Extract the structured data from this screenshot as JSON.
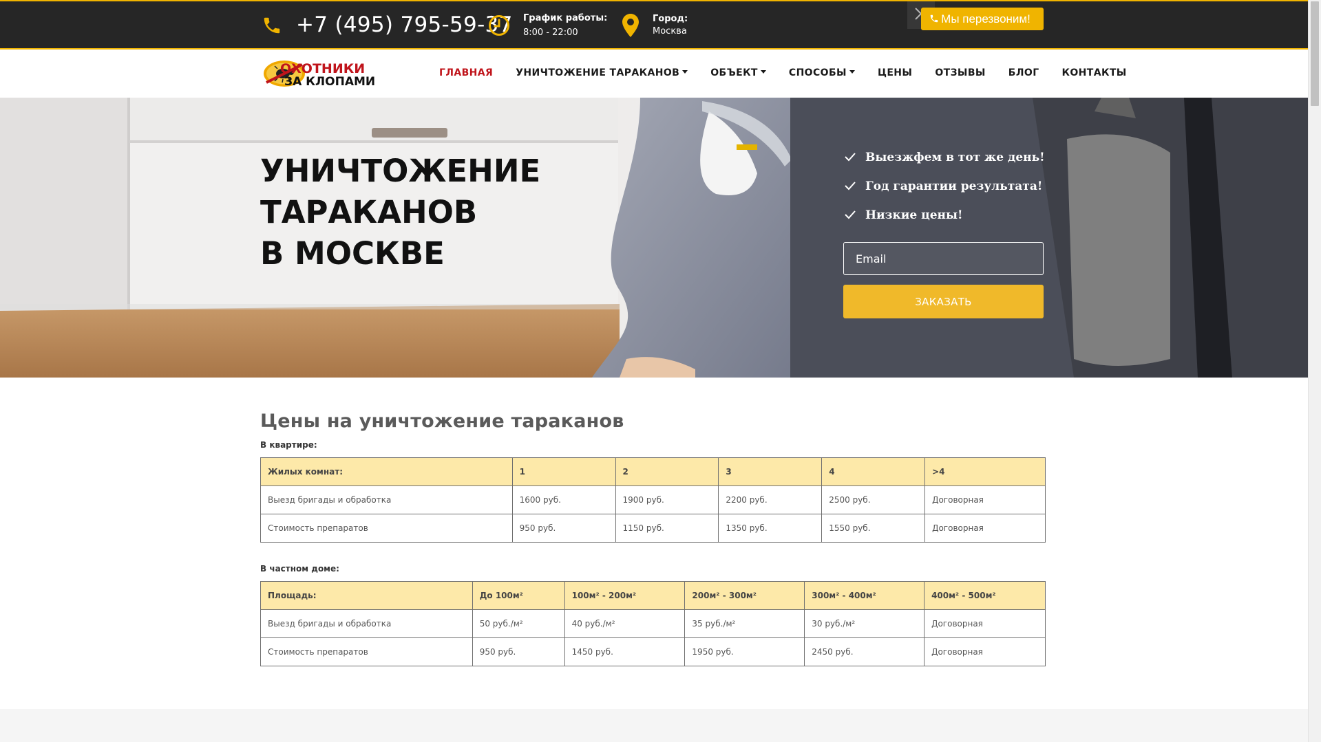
{
  "topbar": {
    "phone": "+7 (495) 795-59-37",
    "hours_label": "График работы:",
    "hours_value": "8:00 - 22:00",
    "city_label": "Город:",
    "city_value": "Москва",
    "callback_label": "Мы перезвоним!",
    "icons": [
      "phone-icon",
      "clock-icon",
      "map-pin-icon",
      "close-icon"
    ],
    "accent_color": "#f0b400",
    "background_color": "#262626"
  },
  "logo": {
    "line1": "ОХОТНИКИ",
    "line2": "ЗА КЛОПАМИ"
  },
  "nav": {
    "items": [
      {
        "label": "ГЛАВНАЯ",
        "active": true,
        "dropdown": false
      },
      {
        "label": "УНИЧТОЖЕНИЕ ТАРАКАНОВ",
        "active": false,
        "dropdown": true
      },
      {
        "label": "ОБЪЕКТ",
        "active": false,
        "dropdown": true
      },
      {
        "label": "СПОСОБЫ",
        "active": false,
        "dropdown": true
      },
      {
        "label": "ЦЕНЫ",
        "active": false,
        "dropdown": false
      },
      {
        "label": "ОТЗЫВЫ",
        "active": false,
        "dropdown": false
      },
      {
        "label": "БЛОГ",
        "active": false,
        "dropdown": false
      },
      {
        "label": "КОНТАКТЫ",
        "active": false,
        "dropdown": false
      }
    ],
    "active_color": "#c0141b"
  },
  "hero": {
    "title_line1": "УНИЧТОЖЕНИЕ ТАРАКАНОВ",
    "title_line2": "В МОСКВЕ",
    "benefits": [
      "Выезжфем в тот же день!",
      "Год гарантии результата!",
      "Низкие цены!"
    ],
    "email_placeholder": "Email",
    "order_button": "ЗАКАЗАТЬ",
    "button_color": "#f0b92a"
  },
  "prices": {
    "title": "Цены на уничтожение тараканов",
    "apartment": {
      "caption": "В квартире:",
      "header": [
        "Жилых комнат:",
        "1",
        "2",
        "3",
        "4",
        ">4"
      ],
      "rows": [
        [
          "Выезд бригады и обработка",
          "1600 руб.",
          "1900 руб.",
          "2200 руб.",
          "2500 руб.",
          "Договорная"
        ],
        [
          "Стоимость препаратов",
          "950 руб.",
          "1150 руб.",
          "1350 руб.",
          "1550 руб.",
          "Договорная"
        ]
      ]
    },
    "house": {
      "caption": "В частном доме:",
      "header": [
        "Площадь:",
        "До 100м²",
        "100м² - 200м²",
        "200м² - 300м²",
        "300м² - 400м²",
        "400м² - 500м²"
      ],
      "rows": [
        [
          "Выезд бригады и обработка",
          "50 руб./м²",
          "40 руб./м²",
          "35 руб./м²",
          "30 руб./м²",
          "Договорная"
        ],
        [
          "Стоимость препаратов",
          "950 руб.",
          "1450 руб.",
          "1950 руб.",
          "2450 руб.",
          "Договорная"
        ]
      ]
    },
    "header_fill": "#fde9a9"
  }
}
